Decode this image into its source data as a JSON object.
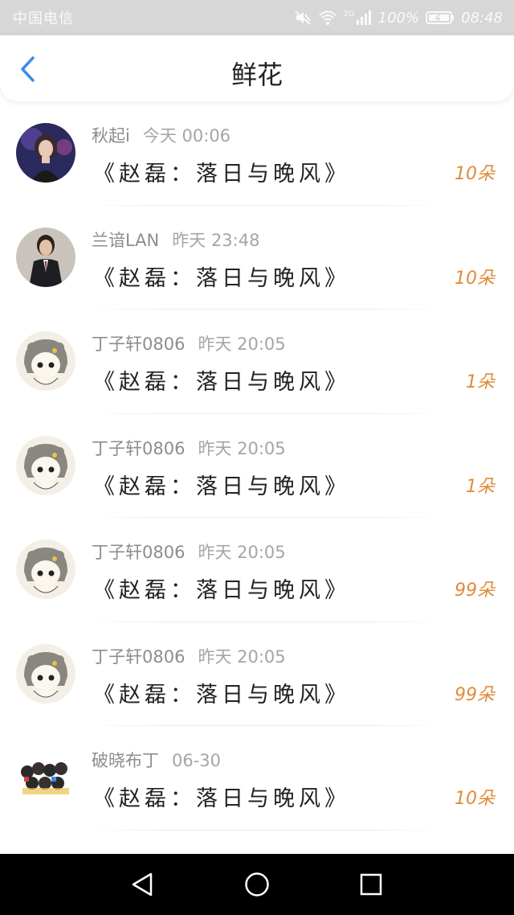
{
  "status_bar": {
    "carrier": "中国电信",
    "network": "2G",
    "battery_pct": "100%",
    "time": "08:48",
    "icons": [
      "mute-icon",
      "wifi-icon",
      "signal-icon",
      "battery-icon"
    ]
  },
  "header": {
    "title": "鲜花",
    "back_icon": "chevron-left-icon",
    "accent_color": "#3a8fe6"
  },
  "items": [
    {
      "user": "秋起i",
      "time": "今天 00:06",
      "work": "《赵磊：落日与晚风》",
      "count": "10朵",
      "avatar": "portrait-girl"
    },
    {
      "user": "兰谙LAN",
      "time": "昨天 23:48",
      "work": "《赵磊：落日与晚风》",
      "count": "10朵",
      "avatar": "portrait-suit"
    },
    {
      "user": "丁子轩0806",
      "time": "昨天 20:05",
      "work": "《赵磊：落日与晚风》",
      "count": "1朵",
      "avatar": "cartoon-girl"
    },
    {
      "user": "丁子轩0806",
      "time": "昨天 20:05",
      "work": "《赵磊：落日与晚风》",
      "count": "1朵",
      "avatar": "cartoon-girl"
    },
    {
      "user": "丁子轩0806",
      "time": "昨天 20:05",
      "work": "《赵磊：落日与晚风》",
      "count": "99朵",
      "avatar": "cartoon-girl"
    },
    {
      "user": "丁子轩0806",
      "time": "昨天 20:05",
      "work": "《赵磊：落日与晚风》",
      "count": "99朵",
      "avatar": "cartoon-girl"
    },
    {
      "user": "破晓布丁",
      "time": "06-30",
      "work": "《赵磊：落日与晚风》",
      "count": "10朵",
      "avatar": "group-cartoon"
    }
  ],
  "colors": {
    "count": "#e08b3a",
    "status_bar_bg": "#d7d7d7",
    "nav_bar_bg": "#000000"
  },
  "nav_bar": {
    "icons": [
      "back-triangle-icon",
      "home-circle-icon",
      "recents-square-icon"
    ]
  }
}
